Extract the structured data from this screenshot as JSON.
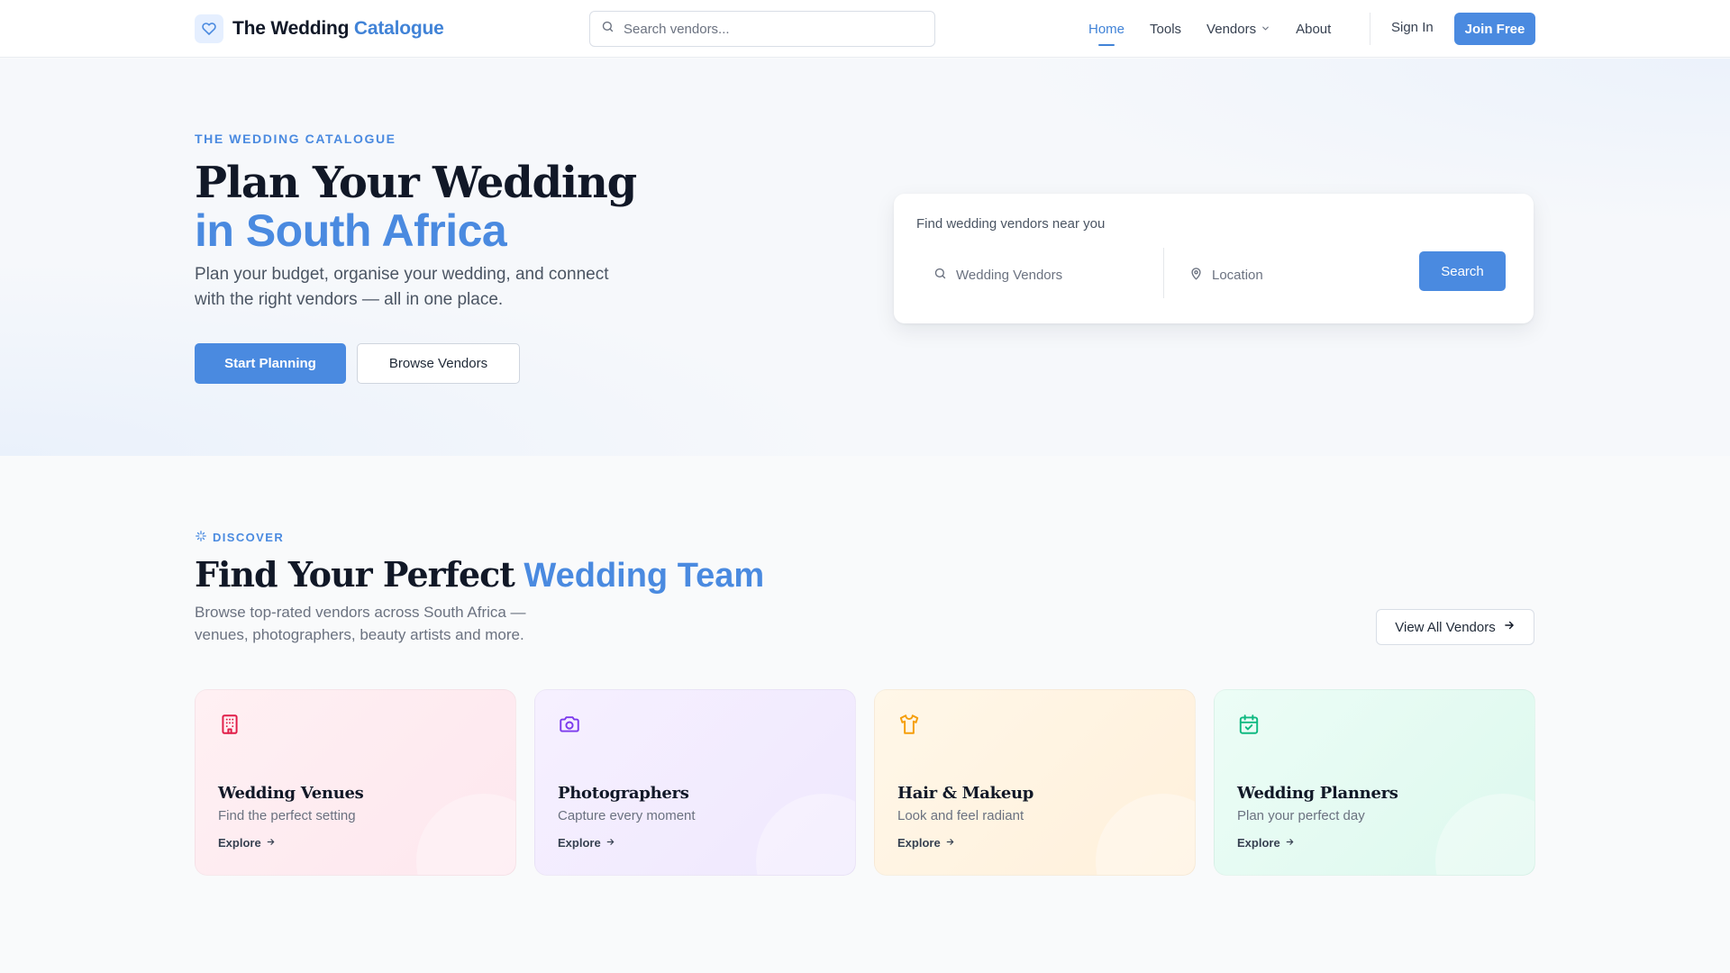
{
  "colors": {
    "accent": "#4a8ae0",
    "venues": "#e11d48",
    "photographers": "#7c3aed",
    "hair_makeup": "#f59e0b",
    "planners": "#10b981"
  },
  "header": {
    "brand_prefix": "The Wedding",
    "brand_accent": "Catalogue",
    "logo_icon": "heart-icon",
    "search_placeholder": "Search vendors...",
    "nav": {
      "home": "Home",
      "tools": "Tools",
      "vendors": "Vendors",
      "about": "About"
    },
    "active_nav": "Home",
    "sign_in": "Sign In",
    "join": "Join Free"
  },
  "hero": {
    "eyebrow": "THE WEDDING CATALOGUE",
    "title_line1": "Plan Your Wedding",
    "title_line2": "in South Africa",
    "subtitle": "Plan your budget, organise your wedding, and connect with the right vendors — all in one place.",
    "primary_cta": "Start Planning",
    "secondary_cta": "Browse Vendors"
  },
  "finder": {
    "title": "Find wedding vendors near you",
    "vendor_placeholder": "Wedding Vendors",
    "location_placeholder": "Location",
    "search_button": "Search"
  },
  "discover": {
    "eyebrow": "DISCOVER",
    "title_main": "Find Your Perfect",
    "title_accent": "Wedding Team",
    "subtitle": "Browse top-rated vendors across South Africa — venues, photographers, beauty artists and more.",
    "view_all": "View All Vendors",
    "cards": [
      {
        "icon": "building-icon",
        "title": "Wedding Venues",
        "desc": "Find the perfect setting",
        "cta": "Explore"
      },
      {
        "icon": "camera-icon",
        "title": "Photographers",
        "desc": "Capture every moment",
        "cta": "Explore"
      },
      {
        "icon": "shirt-icon",
        "title": "Hair & Makeup",
        "desc": "Look and feel radiant",
        "cta": "Explore"
      },
      {
        "icon": "calendar-check-icon",
        "title": "Wedding Planners",
        "desc": "Plan your perfect day",
        "cta": "Explore"
      }
    ]
  }
}
